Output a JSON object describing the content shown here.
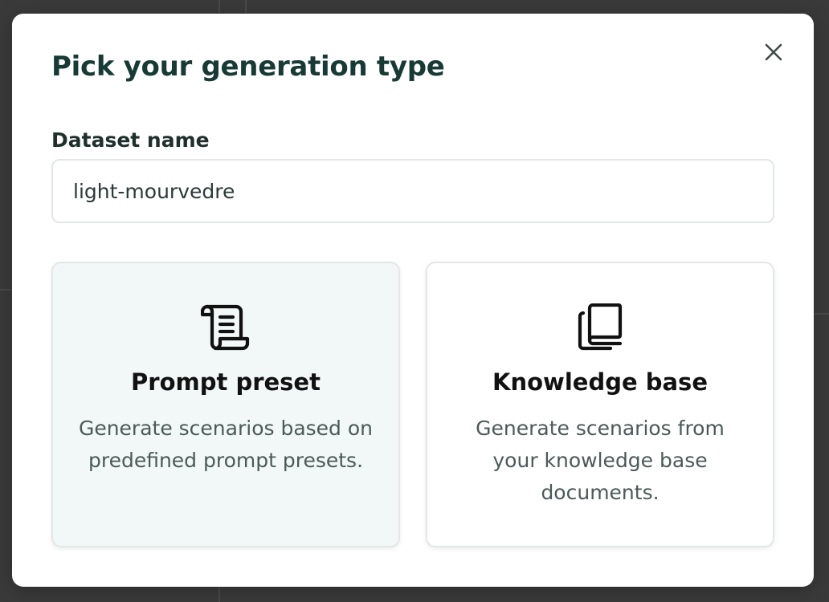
{
  "modal": {
    "title": "Pick your generation type",
    "close_icon": "close-icon"
  },
  "dataset": {
    "label": "Dataset name",
    "value": "light-mourvedre"
  },
  "options": [
    {
      "icon": "scroll-icon",
      "title": "Prompt preset",
      "description": "Generate scenarios based on predefined prompt presets.",
      "selected": true
    },
    {
      "icon": "books-icon",
      "title": "Knowledge base",
      "description": "Generate scenarios from your knowledge base documents.",
      "selected": false
    }
  ],
  "colors": {
    "overlay": "#3a3a3a",
    "title": "#173a35",
    "selected_card_bg": "#f1f8f7"
  }
}
